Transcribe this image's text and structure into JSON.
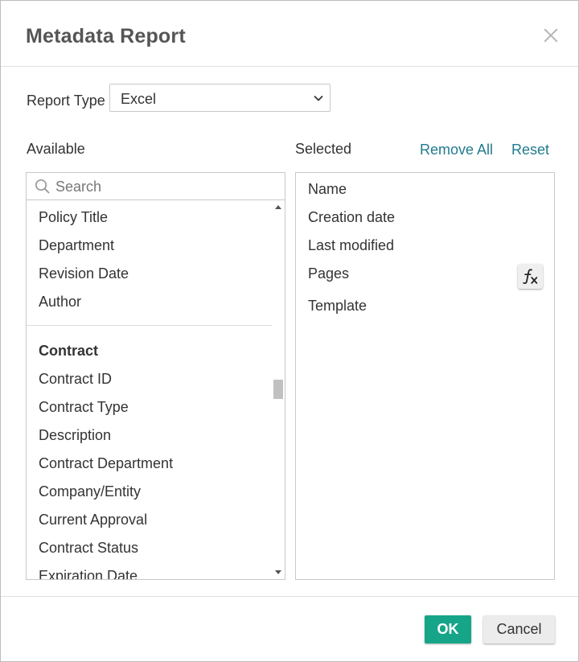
{
  "dialog": {
    "title": "Metadata Report",
    "close_icon": "close-icon"
  },
  "report_type": {
    "label": "Report Type",
    "selected": "Excel"
  },
  "available": {
    "label": "Available",
    "search_placeholder": "Search",
    "items": [
      {
        "label": "Policy Title",
        "group": false
      },
      {
        "label": "Department",
        "group": false
      },
      {
        "label": "Revision Date",
        "group": false
      },
      {
        "label": "Author",
        "group": false
      },
      {
        "label": "Contract",
        "group": true
      },
      {
        "label": "Contract ID",
        "group": false
      },
      {
        "label": "Contract Type",
        "group": false
      },
      {
        "label": "Description",
        "group": false
      },
      {
        "label": "Contract Department",
        "group": false
      },
      {
        "label": "Company/Entity",
        "group": false
      },
      {
        "label": "Current Approval",
        "group": false
      },
      {
        "label": "Contract Status",
        "group": false
      },
      {
        "label": "Expiration Date",
        "group": false
      }
    ]
  },
  "selected": {
    "label": "Selected",
    "remove_all": "Remove All",
    "reset": "Reset",
    "items": [
      "Name",
      "Creation date",
      "Last modified",
      "Pages",
      "Template"
    ],
    "formula_icon": "fx-icon"
  },
  "footer": {
    "ok_label": "OK",
    "cancel_label": "Cancel"
  },
  "colors": {
    "accent": "#17a589",
    "link": "#227b8f",
    "title": "#555555"
  }
}
